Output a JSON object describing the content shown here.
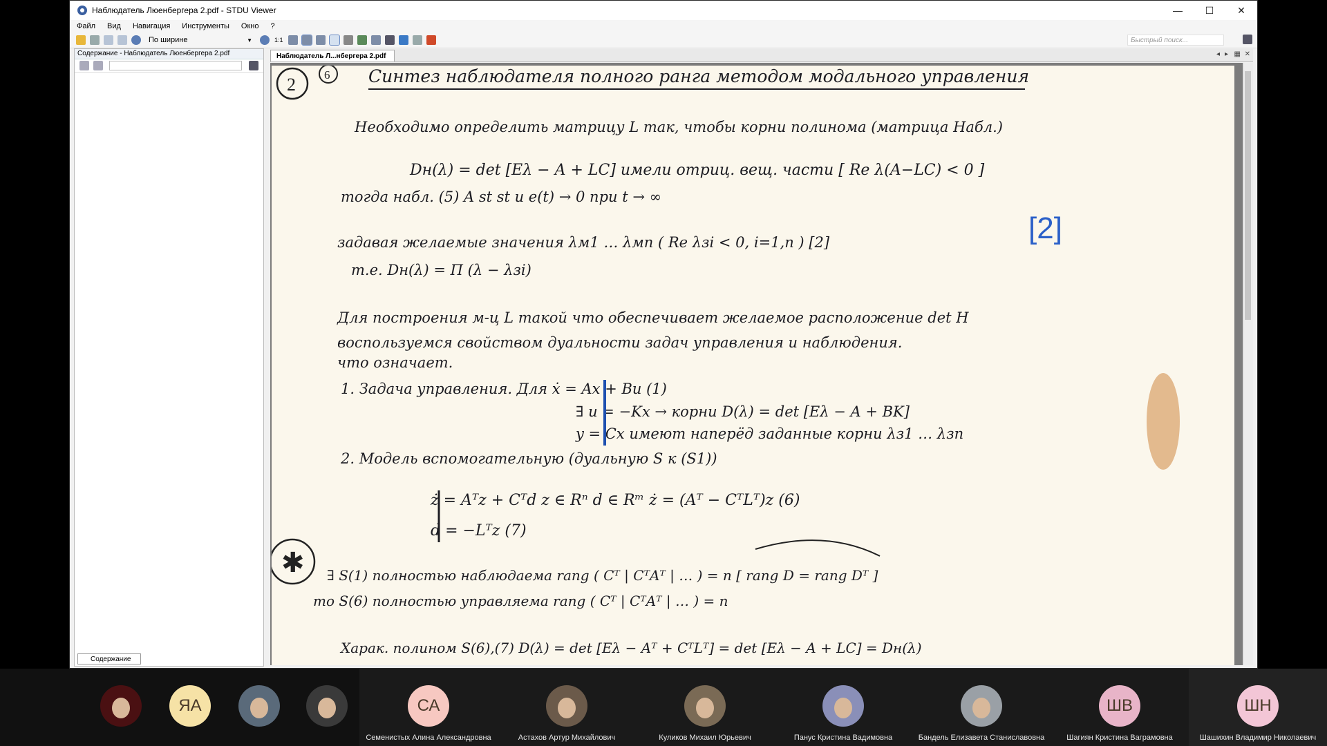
{
  "window": {
    "title": "Наблюдатель Люенбергера 2.pdf - STDU Viewer",
    "controls": [
      "—",
      "☐",
      "✕"
    ]
  },
  "menu": [
    "Файл",
    "Вид",
    "Навигация",
    "Инструменты",
    "Окно",
    "?"
  ],
  "toolbar": {
    "zoom_value": "По ширине",
    "page_fit_label": "1:1",
    "quick_search_placeholder": "Быстрый поиск..."
  },
  "left_panel": {
    "header": "Содержание - Наблюдатель Люенбергера 2.pdf",
    "tab_label": "Содержание"
  },
  "doc_tab": {
    "label": "Наблюдатель Л...нбергера 2.pdf"
  },
  "document": {
    "title": "Синтез наблюдателя полного ранга методом модального управления",
    "lines": [
      "Необходимо определить матрицу L так, чтобы корни полинома (матрица Набл.)",
      "Dн(λ) = det [Eλ − A + LC]   имели отриц. вещ. части   [ Re λ(A−LC) < 0 ]",
      "тогда набл. (5) A st st  и  e(t) → 0  при t → ∞",
      "задавая желаемые значения  λм1 … λмn  ( Re λзi < 0, i=1,n )        [2]",
      "т.е.  Dн(λ) = Π (λ − λзi)",
      "Для построения м-ц L такой что обеспечивает желаемое расположение det H",
      "воспользуемся свойством дуальности задач управления и наблюдения.",
      "что означает.",
      "1. Задача управления. Для   ẋ = Ax + Bu (1)",
      "∃ u = −Kx  → корни D(λ) = det [Eλ − A + BK]",
      "y = Cx   имеют наперёд заданные корни λз1 … λзn",
      "2. Модель вспомогательную (дуальную S к (S1))",
      "ż = Aᵀz + Cᵀd      z ∈ Rⁿ    d ∈ Rᵐ          ż = (Aᵀ − CᵀLᵀ)z     (6)",
      "d = −Lᵀz                                                          (7)",
      "∃ S(1) полностью наблюдаема   rang ( Cᵀ | CᵀAᵀ | … ) = n    [ rang D = rang Dᵀ ]",
      "то S(6) полностью управляема   rang ( Cᵀ | CᵀAᵀ | … ) = n",
      "Харак. полином S(6),(7)   D(λ) = det [Eλ − Aᵀ + CᵀLᵀ] = det [Eλ − A + LC] = Dн(λ)"
    ],
    "page_marks": [
      "2",
      "6",
      "[2]",
      "✱"
    ]
  },
  "participants": [
    {
      "initials": "",
      "name": "",
      "type": "image",
      "color": "#4a1012"
    },
    {
      "initials": "ЯА",
      "name": "",
      "type": "initials",
      "color": "#f6e2a6"
    },
    {
      "initials": "",
      "name": "",
      "type": "photo",
      "color": "#5a6a7a"
    },
    {
      "initials": "",
      "name": "",
      "type": "photo",
      "color": "#3a3a3a"
    },
    {
      "initials": "СА",
      "name": "Семенистых Алина Александровна",
      "type": "initials",
      "color": "#f7c8c1"
    },
    {
      "initials": "",
      "name": "Астахов Артур Михайлович",
      "type": "photo",
      "color": "#6b5a4a"
    },
    {
      "initials": "",
      "name": "Куликов Михаил Юрьевич",
      "type": "photo",
      "color": "#7a6a55"
    },
    {
      "initials": "",
      "name": "Панус Кристина Вадимовна",
      "type": "photo",
      "color": "#8a8fb8"
    },
    {
      "initials": "",
      "name": "Бандель Елизавета Станиславовна",
      "type": "photo",
      "color": "#9aa0a6"
    },
    {
      "initials": "ШВ",
      "name": "Шагиян Кристина Ваграмовна",
      "type": "initials",
      "color": "#e8b4c8"
    },
    {
      "initials": "ШН",
      "name": "Шашихин Владимир Николаевич",
      "type": "initials",
      "color": "#f3c6d6"
    }
  ]
}
